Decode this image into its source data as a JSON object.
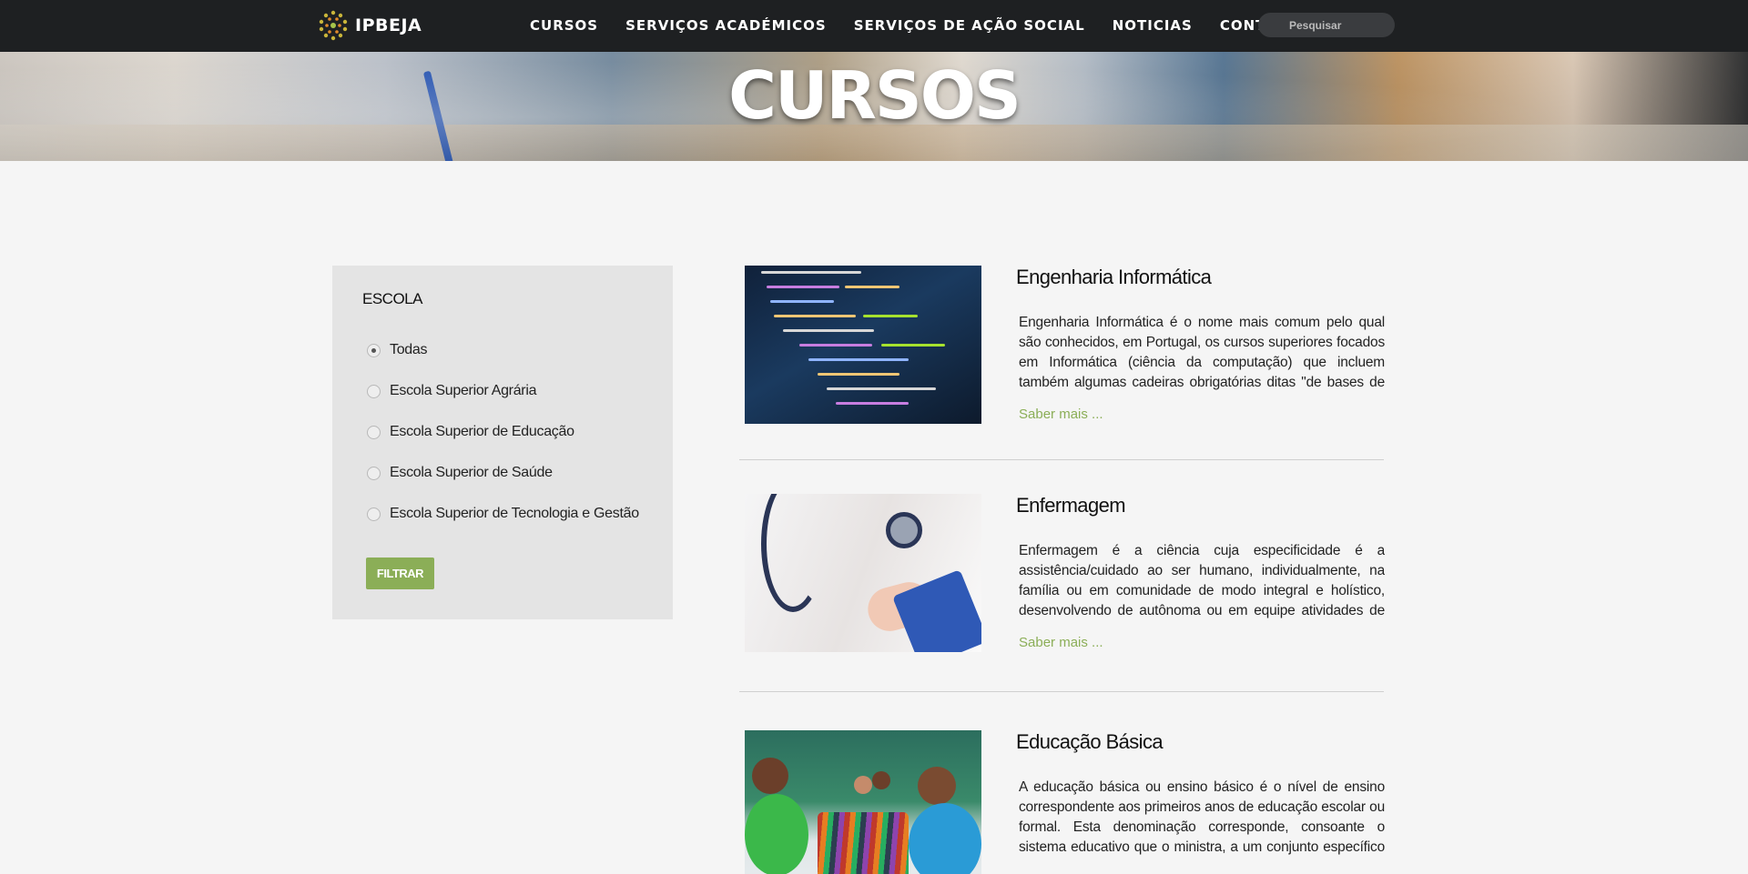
{
  "brand": {
    "name": "IPBEJA"
  },
  "nav": {
    "items": [
      "CURSOS",
      "SERVIÇOS ACADÉMICOS",
      "SERVIÇOS DE AÇÃO SOCIAL",
      "NOTICIAS",
      "CONTACTOS"
    ],
    "search_placeholder": "Pesquisar"
  },
  "hero": {
    "title": "CURSOS"
  },
  "filter": {
    "heading": "ESCOLA",
    "options": [
      {
        "label": "Todas",
        "selected": true
      },
      {
        "label": "Escola Superior Agrária",
        "selected": false
      },
      {
        "label": "Escola Superior de Educação",
        "selected": false
      },
      {
        "label": "Escola Superior de Saúde",
        "selected": false
      },
      {
        "label": "Escola Superior de Tecnologia e Gestão",
        "selected": false
      }
    ],
    "button_label": "FILTRAR"
  },
  "courses": [
    {
      "title": "Engenharia Informática",
      "description": "Engenharia Informática é o nome mais comum pelo qual são conhecidos, em Portugal, os cursos superiores focados em Informática (ciência da computação) que incluem também algumas cadeiras obrigatórias ditas \"de bases de engenharia\"",
      "more_label": "Saber mais  ...",
      "image": "code-editor-screen"
    },
    {
      "title": "Enfermagem",
      "description": "Enfermagem é a ciência cuja especificidade é a assistência/cuidado ao ser humano, individualmente, na família ou em comunidade de modo integral e holístico, desenvolvendo de autônoma ou em equipe atividades de promoção, proteção,",
      "more_label": "Saber mais  ...",
      "image": "nurse-with-stethoscope"
    },
    {
      "title": "Educação Básica",
      "description": "A educação básica ou ensino básico é o nível de ensino correspondente aos primeiros anos de educação escolar ou formal. Esta denominação corresponde, consoante o sistema educativo que o ministra, a um conjunto específico de anos de escolari-",
      "more_label": "Saber mais  ...",
      "image": "children-classroom-pencils"
    }
  ],
  "colors": {
    "topbar": "#1e2022",
    "accent_green": "#8bae57",
    "filter_panel": "#e4e4e4",
    "page_bg": "#f5f5f5"
  }
}
